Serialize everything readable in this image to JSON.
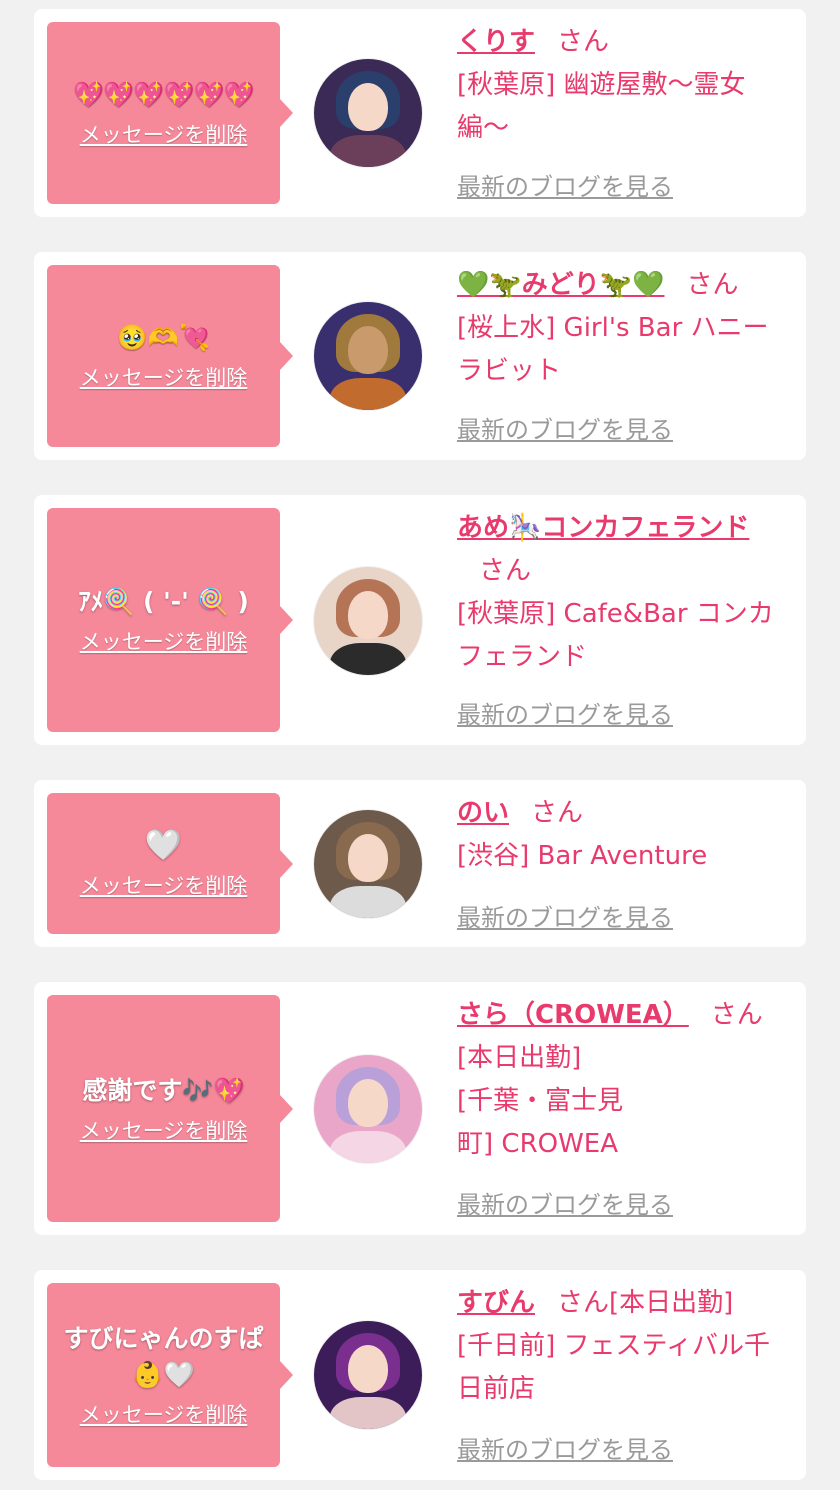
{
  "colors": {
    "page_bg": "#f1f1f1",
    "card_bg": "#ffffff",
    "bubble_bg": "#f5899a",
    "accent_text": "#e83a6c",
    "blog_link": "#9a9a9a"
  },
  "common": {
    "delete_label": "メッセージを削除",
    "san": "さん",
    "blog_label": "最新のブログを見る"
  },
  "items": [
    {
      "message": "💖💖💖💖💖💖",
      "name": "くりす",
      "shop": "[秋葉原] 幽遊屋敷〜霊女編〜",
      "avatar_colors": [
        "#6b3f5a",
        "#2a3f6b",
        "#f2c9d8"
      ]
    },
    {
      "message": "🥹🫶💘",
      "name": "💚🦖みどり🦖💚",
      "shop": "[桜上水] Girl's Bar ハニーラビット",
      "avatar_colors": [
        "#3a2f6e",
        "#a07a3c",
        "#c26b2f"
      ]
    },
    {
      "message": "ｱﾒ🍭 ( '-' 🍭 )",
      "name": "あめ🎠コンカフェランド",
      "shop": "[秋葉原] Cafe&Bar コンカフェランド",
      "avatar_colors": [
        "#e8d5c8",
        "#b57456",
        "#2b2b2b"
      ]
    },
    {
      "message": "🤍",
      "name": "のい",
      "shop": "[渋谷] Bar Aventure",
      "avatar_colors": [
        "#6e5a4b",
        "#8a6a4e",
        "#dcdcdc"
      ]
    },
    {
      "message": "感謝です🎶💖",
      "name": "さら（CROWEA）",
      "shop_prefix": "[本日出勤]",
      "shop": "[千葉・富士見町] CROWEA",
      "avatar_colors": [
        "#e9a6c9",
        "#b9a0d8",
        "#f4d6e4"
      ]
    },
    {
      "message": "すびにゃんのすぱ👶🤍",
      "name": "すびん",
      "suffix": "[本日出勤]",
      "shop": "[千日前] フェスティバル千日前店",
      "avatar_colors": [
        "#3c1d5a",
        "#7a2f8f",
        "#e3c5c8"
      ]
    }
  ]
}
